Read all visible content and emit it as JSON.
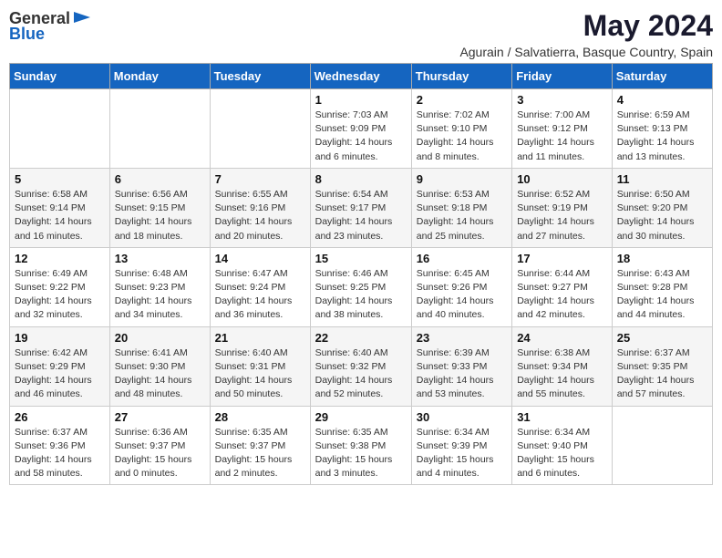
{
  "logo": {
    "general": "General",
    "blue": "Blue"
  },
  "title": "May 2024",
  "location": "Agurain / Salvatierra, Basque Country, Spain",
  "weekdays": [
    "Sunday",
    "Monday",
    "Tuesday",
    "Wednesday",
    "Thursday",
    "Friday",
    "Saturday"
  ],
  "weeks": [
    [
      {
        "day": "",
        "info": ""
      },
      {
        "day": "",
        "info": ""
      },
      {
        "day": "",
        "info": ""
      },
      {
        "day": "1",
        "info": "Sunrise: 7:03 AM\nSunset: 9:09 PM\nDaylight: 14 hours\nand 6 minutes."
      },
      {
        "day": "2",
        "info": "Sunrise: 7:02 AM\nSunset: 9:10 PM\nDaylight: 14 hours\nand 8 minutes."
      },
      {
        "day": "3",
        "info": "Sunrise: 7:00 AM\nSunset: 9:12 PM\nDaylight: 14 hours\nand 11 minutes."
      },
      {
        "day": "4",
        "info": "Sunrise: 6:59 AM\nSunset: 9:13 PM\nDaylight: 14 hours\nand 13 minutes."
      }
    ],
    [
      {
        "day": "5",
        "info": "Sunrise: 6:58 AM\nSunset: 9:14 PM\nDaylight: 14 hours\nand 16 minutes."
      },
      {
        "day": "6",
        "info": "Sunrise: 6:56 AM\nSunset: 9:15 PM\nDaylight: 14 hours\nand 18 minutes."
      },
      {
        "day": "7",
        "info": "Sunrise: 6:55 AM\nSunset: 9:16 PM\nDaylight: 14 hours\nand 20 minutes."
      },
      {
        "day": "8",
        "info": "Sunrise: 6:54 AM\nSunset: 9:17 PM\nDaylight: 14 hours\nand 23 minutes."
      },
      {
        "day": "9",
        "info": "Sunrise: 6:53 AM\nSunset: 9:18 PM\nDaylight: 14 hours\nand 25 minutes."
      },
      {
        "day": "10",
        "info": "Sunrise: 6:52 AM\nSunset: 9:19 PM\nDaylight: 14 hours\nand 27 minutes."
      },
      {
        "day": "11",
        "info": "Sunrise: 6:50 AM\nSunset: 9:20 PM\nDaylight: 14 hours\nand 30 minutes."
      }
    ],
    [
      {
        "day": "12",
        "info": "Sunrise: 6:49 AM\nSunset: 9:22 PM\nDaylight: 14 hours\nand 32 minutes."
      },
      {
        "day": "13",
        "info": "Sunrise: 6:48 AM\nSunset: 9:23 PM\nDaylight: 14 hours\nand 34 minutes."
      },
      {
        "day": "14",
        "info": "Sunrise: 6:47 AM\nSunset: 9:24 PM\nDaylight: 14 hours\nand 36 minutes."
      },
      {
        "day": "15",
        "info": "Sunrise: 6:46 AM\nSunset: 9:25 PM\nDaylight: 14 hours\nand 38 minutes."
      },
      {
        "day": "16",
        "info": "Sunrise: 6:45 AM\nSunset: 9:26 PM\nDaylight: 14 hours\nand 40 minutes."
      },
      {
        "day": "17",
        "info": "Sunrise: 6:44 AM\nSunset: 9:27 PM\nDaylight: 14 hours\nand 42 minutes."
      },
      {
        "day": "18",
        "info": "Sunrise: 6:43 AM\nSunset: 9:28 PM\nDaylight: 14 hours\nand 44 minutes."
      }
    ],
    [
      {
        "day": "19",
        "info": "Sunrise: 6:42 AM\nSunset: 9:29 PM\nDaylight: 14 hours\nand 46 minutes."
      },
      {
        "day": "20",
        "info": "Sunrise: 6:41 AM\nSunset: 9:30 PM\nDaylight: 14 hours\nand 48 minutes."
      },
      {
        "day": "21",
        "info": "Sunrise: 6:40 AM\nSunset: 9:31 PM\nDaylight: 14 hours\nand 50 minutes."
      },
      {
        "day": "22",
        "info": "Sunrise: 6:40 AM\nSunset: 9:32 PM\nDaylight: 14 hours\nand 52 minutes."
      },
      {
        "day": "23",
        "info": "Sunrise: 6:39 AM\nSunset: 9:33 PM\nDaylight: 14 hours\nand 53 minutes."
      },
      {
        "day": "24",
        "info": "Sunrise: 6:38 AM\nSunset: 9:34 PM\nDaylight: 14 hours\nand 55 minutes."
      },
      {
        "day": "25",
        "info": "Sunrise: 6:37 AM\nSunset: 9:35 PM\nDaylight: 14 hours\nand 57 minutes."
      }
    ],
    [
      {
        "day": "26",
        "info": "Sunrise: 6:37 AM\nSunset: 9:36 PM\nDaylight: 14 hours\nand 58 minutes."
      },
      {
        "day": "27",
        "info": "Sunrise: 6:36 AM\nSunset: 9:37 PM\nDaylight: 15 hours\nand 0 minutes."
      },
      {
        "day": "28",
        "info": "Sunrise: 6:35 AM\nSunset: 9:37 PM\nDaylight: 15 hours\nand 2 minutes."
      },
      {
        "day": "29",
        "info": "Sunrise: 6:35 AM\nSunset: 9:38 PM\nDaylight: 15 hours\nand 3 minutes."
      },
      {
        "day": "30",
        "info": "Sunrise: 6:34 AM\nSunset: 9:39 PM\nDaylight: 15 hours\nand 4 minutes."
      },
      {
        "day": "31",
        "info": "Sunrise: 6:34 AM\nSunset: 9:40 PM\nDaylight: 15 hours\nand 6 minutes."
      },
      {
        "day": "",
        "info": ""
      }
    ]
  ]
}
